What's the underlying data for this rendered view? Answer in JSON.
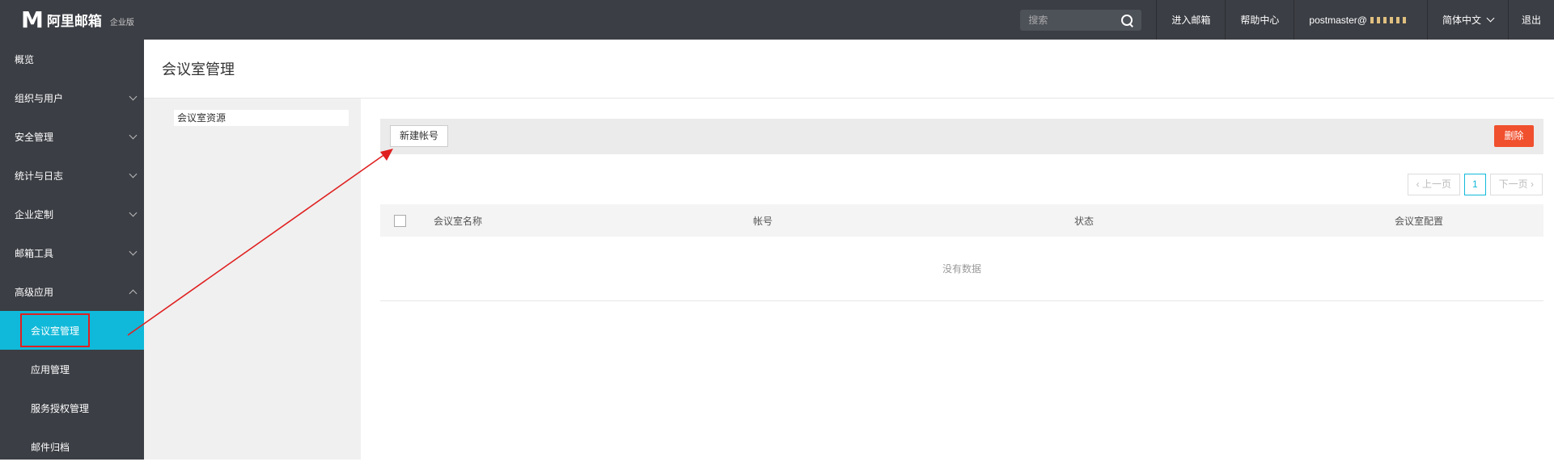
{
  "header": {
    "logo_mark": "M",
    "logo_name": "阿里邮箱",
    "logo_edition": "企业版",
    "search_placeholder": "搜索",
    "links": [
      "进入邮箱",
      "帮助中心",
      "postmaster@"
    ],
    "language": "简体中文",
    "logout": "退出"
  },
  "sidebar": {
    "items": [
      {
        "label": "概览"
      },
      {
        "label": "组织与用户"
      },
      {
        "label": "安全管理"
      },
      {
        "label": "统计与日志"
      },
      {
        "label": "企业定制"
      },
      {
        "label": "邮箱工具"
      },
      {
        "label": "高级应用"
      }
    ],
    "subitems": [
      {
        "label": "会议室管理"
      },
      {
        "label": "应用管理"
      },
      {
        "label": "服务授权管理"
      },
      {
        "label": "邮件归档"
      }
    ]
  },
  "page": {
    "title": "会议室管理",
    "resource_item": "会议室资源"
  },
  "toolbar": {
    "new_label": "新建帐号",
    "delete_label": "删除"
  },
  "pager": {
    "prev": "‹ 上一页",
    "current": "1",
    "next": "下一页 ›"
  },
  "table": {
    "columns": [
      "会议室名称",
      "帐号",
      "状态",
      "会议室配置"
    ],
    "empty_text": "没有数据"
  },
  "colors": {
    "topbar": "#3b3e44",
    "active": "#10b9d9",
    "delete": "#f0502e",
    "annotation": "#e02020"
  }
}
